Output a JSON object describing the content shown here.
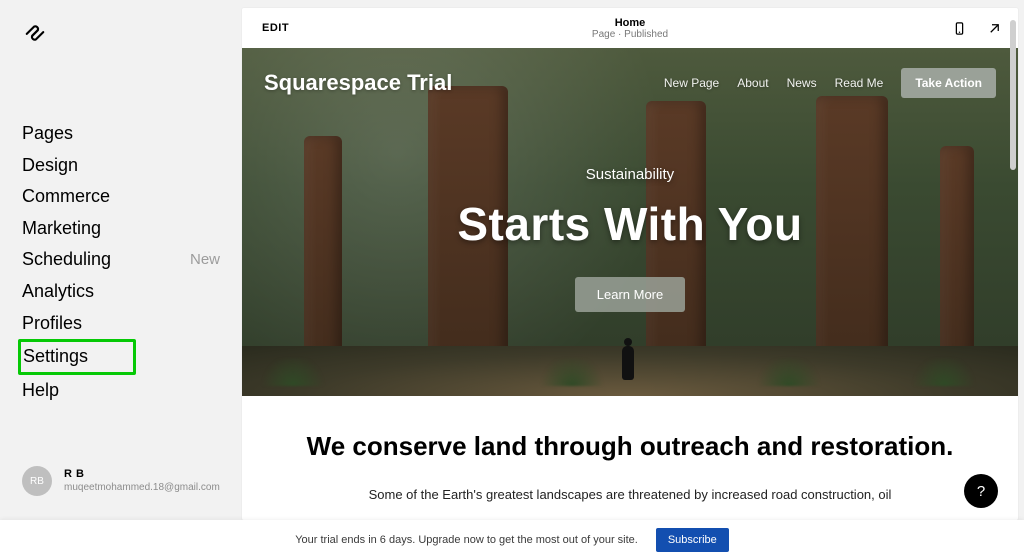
{
  "sidebar": {
    "items": [
      {
        "label": "Pages",
        "badge": ""
      },
      {
        "label": "Design",
        "badge": ""
      },
      {
        "label": "Commerce",
        "badge": ""
      },
      {
        "label": "Marketing",
        "badge": ""
      },
      {
        "label": "Scheduling",
        "badge": "New"
      },
      {
        "label": "Analytics",
        "badge": ""
      },
      {
        "label": "Profiles",
        "badge": ""
      },
      {
        "label": "Settings",
        "badge": ""
      },
      {
        "label": "Help",
        "badge": ""
      }
    ],
    "highlight_index": 7
  },
  "user": {
    "avatar": "RB",
    "name": "R B",
    "email": "muqeetmohammed.18@gmail.com"
  },
  "topbar": {
    "edit": "EDIT",
    "title": "Home",
    "subtitle": "Page · Published"
  },
  "hero": {
    "brand": "Squarespace Trial",
    "nav": [
      "New Page",
      "About",
      "News",
      "Read Me"
    ],
    "cta": "Take Action",
    "eyebrow": "Sustainability",
    "headline": "Starts With You",
    "learn": "Learn More"
  },
  "bodycopy": {
    "headline": "We conserve land through outreach and restoration.",
    "para": "Some of the Earth's greatest landscapes are threatened by increased road construction, oil"
  },
  "help_fab": "?",
  "trial_bar": {
    "text": "Your trial ends in 6 days. Upgrade now to get the most out of your site.",
    "button": "Subscribe"
  }
}
